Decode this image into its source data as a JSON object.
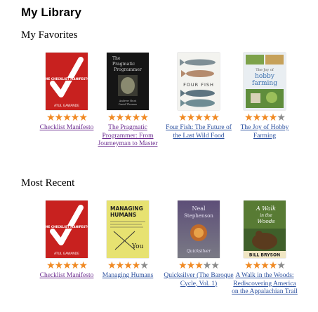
{
  "page": {
    "title": "My Library"
  },
  "sections": [
    {
      "title": "My Favorites",
      "books": [
        {
          "title": "Checklist Manifesto",
          "rating": 5,
          "visited": true,
          "cover": {
            "bg": "#c8211f",
            "text": "THE CHECKLIST MANIFESTO",
            "author": "ATUL GAWANDE"
          }
        },
        {
          "title": "The Pragmatic Programmer: From Journeyman to Master",
          "rating": 5,
          "visited": true,
          "cover": {
            "bg": "#151515",
            "text": "The Pragmatic Programmer",
            "author": "Andrew Hunt  David Thomas"
          }
        },
        {
          "title": "Four Fish: The Future of the Last Wild Food",
          "rating": 5,
          "visited": false,
          "cover": {
            "bg": "#f3f3ef",
            "text": "FOUR FISH",
            "author": ""
          }
        },
        {
          "title": "The Joy of Hobby Farming",
          "rating": 4,
          "visited": false,
          "cover": {
            "bg": "#e9eef2",
            "text": "hobby farming",
            "author": ""
          }
        }
      ]
    },
    {
      "title": "Most Recent",
      "books": [
        {
          "title": "Checklist Manifesto",
          "rating": 5,
          "visited": true,
          "cover": {
            "bg": "#c8211f",
            "text": "THE CHECKLIST MANIFESTO",
            "author": "ATUL GAWANDE"
          }
        },
        {
          "title": "Managing Humans",
          "rating": 4,
          "visited": false,
          "cover": {
            "bg": "#e7e271",
            "text": "MANAGING HUMANS",
            "author": "You"
          }
        },
        {
          "title": "Quicksilver (The Baroque Cycle, Vol. 1)",
          "rating": 3,
          "visited": false,
          "cover": {
            "bg": "#6d5b7a",
            "text": "Neal Stephenson",
            "author": "Quicksilver"
          }
        },
        {
          "title": "A Walk in the Woods: Rediscovering America on the Appalachian Trail",
          "rating": 4,
          "visited": false,
          "cover": {
            "bg": "#4b6b2c",
            "text": "A Walk in the Woods",
            "author": "BILL BRYSON"
          }
        }
      ]
    }
  ],
  "colors": {
    "star_on": "#f08a24",
    "star_off": "#8c8c8c",
    "link": "#2a4f9e",
    "visited": "#6b2b8f"
  }
}
